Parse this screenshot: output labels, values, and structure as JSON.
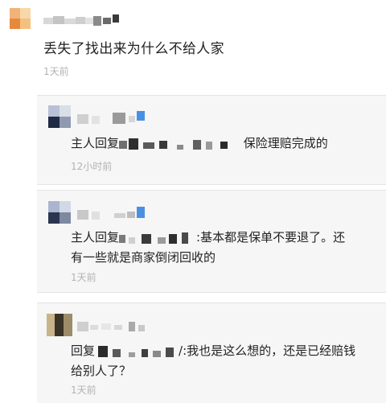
{
  "post": {
    "text": "丢失了找出来为什么不给人家",
    "time": "1天前"
  },
  "replies": [
    {
      "prefix": "主人回复",
      "tail": "保险理赔完成的",
      "line2": "",
      "time": "12小时前"
    },
    {
      "prefix": "主人回复",
      "tail": ":基本都是保单不要退了。还",
      "line2": "有一些就是商家倒闭回收的",
      "time": "1天前"
    },
    {
      "prefix": "回复",
      "tail": "/:我也是这么想的，还是已经赔钱",
      "line2": "给别人了？",
      "time": "1天前"
    }
  ],
  "colors": {
    "accent": "#4a90e2",
    "panel": "#f6f6f6",
    "time": "#b3b3b3"
  }
}
